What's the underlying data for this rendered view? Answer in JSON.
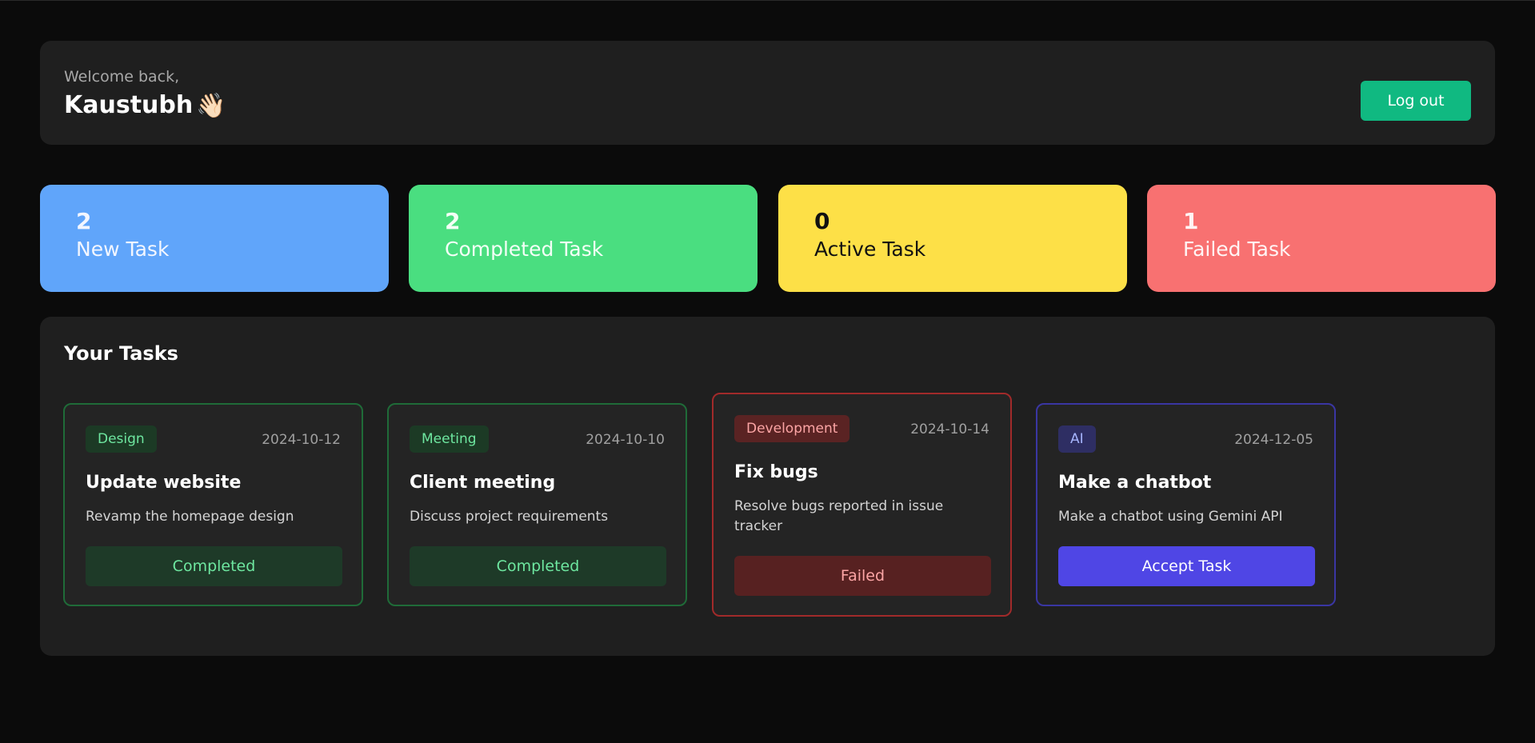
{
  "header": {
    "welcome": "Welcome back,",
    "username": "Kaustubh",
    "wave_emoji": "👋🏻",
    "logout_label": "Log out"
  },
  "stats": [
    {
      "count": "2",
      "label": "New Task",
      "color": "#60a5fa"
    },
    {
      "count": "2",
      "label": "Completed Task",
      "color": "#4ade80"
    },
    {
      "count": "0",
      "label": "Active Task",
      "color": "#fde047"
    },
    {
      "count": "1",
      "label": "Failed Task",
      "color": "#f87171"
    }
  ],
  "tasks": {
    "title": "Your Tasks",
    "items": [
      {
        "tag": "Design",
        "date": "2024-10-12",
        "title": "Update website",
        "description": "Revamp the homepage design",
        "action": "Completed",
        "status": "completed"
      },
      {
        "tag": "Meeting",
        "date": "2024-10-10",
        "title": "Client meeting",
        "description": "Discuss project requirements",
        "action": "Completed",
        "status": "completed"
      },
      {
        "tag": "Development",
        "date": "2024-10-14",
        "title": "Fix bugs",
        "description": "Resolve bugs reported in issue tracker",
        "action": "Failed",
        "status": "failed"
      },
      {
        "tag": "AI",
        "date": "2024-12-05",
        "title": "Make a chatbot",
        "description": "Make a chatbot using Gemini API",
        "action": "Accept Task",
        "status": "new"
      }
    ]
  }
}
